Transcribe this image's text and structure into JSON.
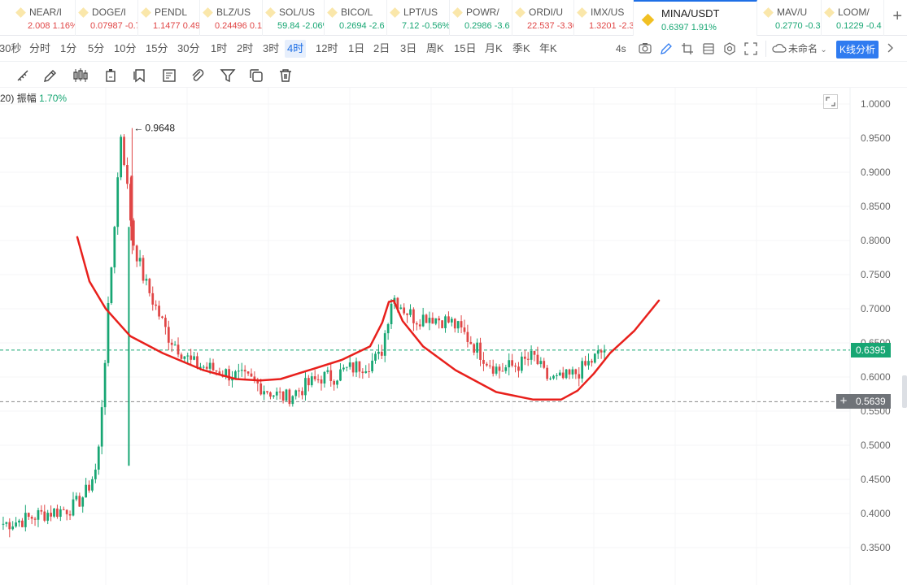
{
  "tickers": [
    {
      "name": "NEAR/I",
      "price": "2.008",
      "change": "1.16%",
      "dir": "down"
    },
    {
      "name": "DOGE/I",
      "price": "0.07987",
      "change": "-0.7",
      "dir": "down"
    },
    {
      "name": "PENDL",
      "price": "1.1477",
      "change": "0.49",
      "dir": "down"
    },
    {
      "name": "BLZ/US",
      "price": "0.24496",
      "change": "0.1",
      "dir": "down"
    },
    {
      "name": "SOL/US",
      "price": "59.84",
      "change": "-2.06%",
      "dir": "up"
    },
    {
      "name": "BICO/L",
      "price": "0.2694",
      "change": "-2.6",
      "dir": "up"
    },
    {
      "name": "LPT/US",
      "price": "7.12",
      "change": "-0.56%",
      "dir": "up"
    },
    {
      "name": "POWR/",
      "price": "0.2986",
      "change": "-3.6",
      "dir": "up"
    },
    {
      "name": "ORDI/U",
      "price": "22.537",
      "change": "-3.36",
      "dir": "down"
    },
    {
      "name": "IMX/US",
      "price": "1.3201",
      "change": "-2.3",
      "dir": "down"
    },
    {
      "name": "MINA/USDT",
      "price": "0.6397",
      "change": "1.91%",
      "dir": "up",
      "active": true
    },
    {
      "name": "MAV/U",
      "price": "0.2770",
      "change": "-0.3",
      "dir": "up"
    },
    {
      "name": "LOOM/",
      "price": "0.1229",
      "change": "-0.4",
      "dir": "up"
    }
  ],
  "add_tab_label": "+",
  "intervals": [
    "30秒",
    "分时",
    "1分",
    "5分",
    "10分",
    "15分",
    "30分",
    "1时",
    "2时",
    "3时",
    "4时",
    "12时",
    "1日",
    "2日",
    "3日",
    "周K",
    "15日",
    "月K",
    "季K",
    "年K"
  ],
  "active_interval": "4时",
  "right_tools": {
    "refresh_interval": "4s",
    "layout_name": "未命名",
    "kline_analysis": "K线分析"
  },
  "draw_tools": [
    "ruler-icon",
    "pen-icon",
    "candles-icon",
    "battery-icon",
    "bookmark-icon",
    "form-icon",
    "paperclip-icon",
    "filter-icon",
    "copy-icon",
    "trash-icon"
  ],
  "legend": {
    "prefix": "20)",
    "amplitude_label": "振幅",
    "amplitude_value": "1.70%"
  },
  "colors": {
    "up": "#17a673",
    "down": "#e04646",
    "accent": "#1e6fe6",
    "annotation": "#e8201c",
    "crosshair_tag": "#6f7378"
  },
  "chart_data": {
    "type": "candlestick",
    "symbol": "MINA/USDT",
    "interval": "4时",
    "y_axis_ticks": [
      "1.0000",
      "0.9500",
      "0.9000",
      "0.8500",
      "0.8000",
      "0.7500",
      "0.7000",
      "0.6500",
      "0.6000",
      "0.5500",
      "0.5000",
      "0.4500",
      "0.4000",
      "0.3500"
    ],
    "ylim": [
      0.33,
      1.02
    ],
    "current_price": "0.6395",
    "crosshair_price": "0.5639",
    "high_marker": "0.9648",
    "close_series_approx": [
      0.385,
      0.388,
      0.392,
      0.398,
      0.402,
      0.405,
      0.41,
      0.43,
      0.47,
      0.72,
      0.96,
      0.8,
      0.74,
      0.7,
      0.66,
      0.64,
      0.62,
      0.615,
      0.61,
      0.605,
      0.6,
      0.595,
      0.585,
      0.575,
      0.57,
      0.58,
      0.59,
      0.6,
      0.6,
      0.61,
      0.615,
      0.62,
      0.63,
      0.72,
      0.7,
      0.685,
      0.69,
      0.685,
      0.68,
      0.665,
      0.645,
      0.625,
      0.61,
      0.615,
      0.62,
      0.63,
      0.6,
      0.595,
      0.6,
      0.61,
      0.625,
      0.64
    ]
  }
}
